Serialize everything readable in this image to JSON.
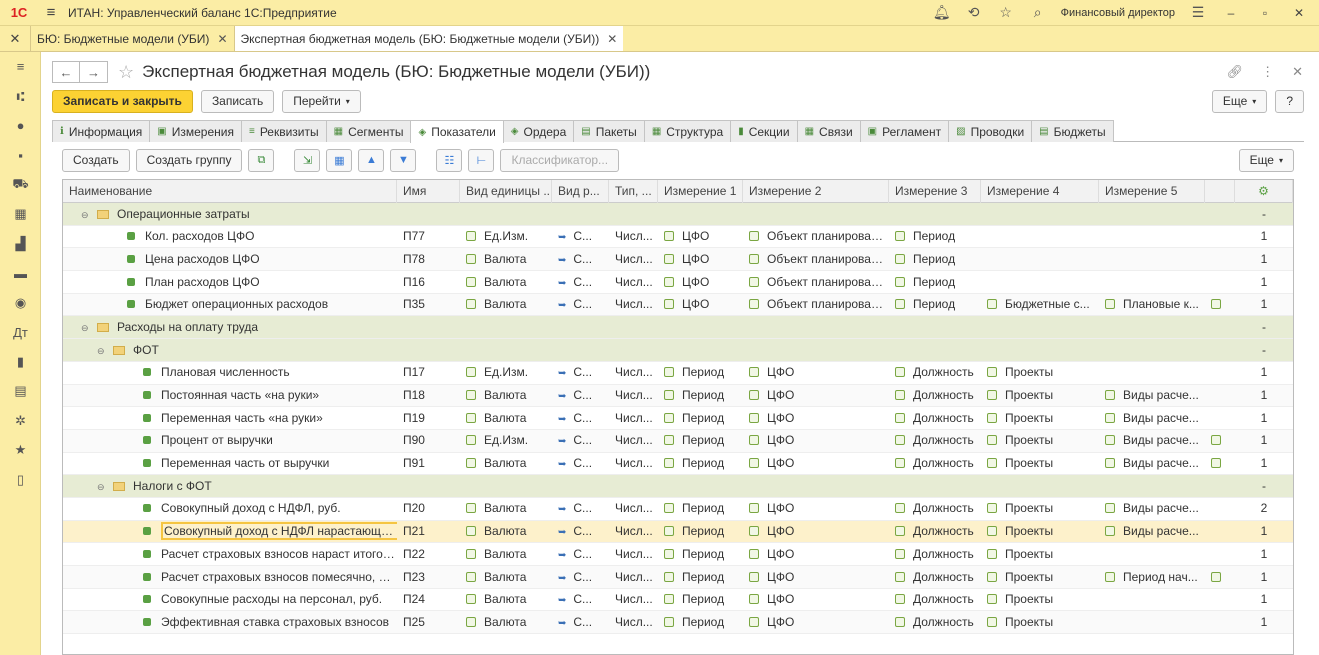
{
  "app": {
    "logo": "1С",
    "title": "ИТАН: Управленческий баланс 1С:Предприятие",
    "user": "Финансовый директор"
  },
  "open_tabs": [
    {
      "label": "БЮ: Бюджетные модели (УБИ)",
      "active": false
    },
    {
      "label": "Экспертная бюджетная модель (БЮ: Бюджетные модели (УБИ))",
      "active": true
    }
  ],
  "form": {
    "title": "Экспертная бюджетная модель (БЮ: Бюджетные модели (УБИ))"
  },
  "commands": {
    "save_close": "Записать и закрыть",
    "save": "Записать",
    "goto": "Перейти",
    "more": "Еще",
    "help": "?"
  },
  "section_tabs": [
    {
      "label": "Информация",
      "icon": "info-icon"
    },
    {
      "label": "Измерения",
      "icon": "dimensions-icon"
    },
    {
      "label": "Реквизиты",
      "icon": "attributes-icon"
    },
    {
      "label": "Сегменты",
      "icon": "segments-icon"
    },
    {
      "label": "Показатели",
      "icon": "indicators-icon",
      "active": true
    },
    {
      "label": "Ордера",
      "icon": "orders-icon"
    },
    {
      "label": "Пакеты",
      "icon": "packages-icon"
    },
    {
      "label": "Структура",
      "icon": "structure-icon"
    },
    {
      "label": "Секции",
      "icon": "sections-icon"
    },
    {
      "label": "Связи",
      "icon": "links-icon"
    },
    {
      "label": "Регламент",
      "icon": "schedule-icon"
    },
    {
      "label": "Проводки",
      "icon": "postings-icon"
    },
    {
      "label": "Бюджеты",
      "icon": "budgets-icon"
    }
  ],
  "table_toolbar": {
    "create": "Создать",
    "create_group": "Создать группу",
    "classifier": "Классификатор...",
    "more": "Еще"
  },
  "columns": [
    "Наименование",
    "Имя",
    "Вид единицы ...",
    "Вид р...",
    "Тип, ...",
    "Измерение 1",
    "Измерение 2",
    "Измерение 3",
    "Измерение 4",
    "Измерение 5",
    "",
    ""
  ],
  "rows": [
    {
      "type": "group",
      "level": 1,
      "name": "Операционные затраты",
      "code": "",
      "unit": "",
      "vid": "",
      "tip": "",
      "d1": "",
      "d2": "",
      "d3": "",
      "d4": "",
      "d5": "",
      "extra": false,
      "n": "-"
    },
    {
      "type": "item",
      "level": 2,
      "name": "Кол. расходов ЦФО",
      "code": "П77",
      "unit": "Ед.Изм.",
      "vid": "С...",
      "tip": "Числ...",
      "d1": "ЦФО",
      "d2": "Объект планирования",
      "d3": "Период",
      "d4": "",
      "d5": "",
      "extra": false,
      "n": "1"
    },
    {
      "type": "item",
      "level": 2,
      "name": "Цена расходов ЦФО",
      "code": "П78",
      "unit": "Валюта",
      "vid": "С...",
      "tip": "Числ...",
      "d1": "ЦФО",
      "d2": "Объект планирования",
      "d3": "Период",
      "d4": "",
      "d5": "",
      "extra": false,
      "n": "1"
    },
    {
      "type": "item",
      "level": 2,
      "name": "План расходов ЦФО",
      "code": "П16",
      "unit": "Валюта",
      "vid": "С...",
      "tip": "Числ...",
      "d1": "ЦФО",
      "d2": "Объект планирования",
      "d3": "Период",
      "d4": "",
      "d5": "",
      "extra": false,
      "n": "1"
    },
    {
      "type": "item",
      "level": 2,
      "name": "Бюджет операционных расходов",
      "code": "П35",
      "unit": "Валюта",
      "vid": "С...",
      "tip": "Числ...",
      "d1": "ЦФО",
      "d2": "Объект планирования",
      "d3": "Период",
      "d4": "Бюджетные с...",
      "d5": "Плановые к...",
      "extra": true,
      "n": "1"
    },
    {
      "type": "group",
      "level": 1,
      "name": "Расходы на оплату труда",
      "code": "",
      "unit": "",
      "vid": "",
      "tip": "",
      "d1": "",
      "d2": "",
      "d3": "",
      "d4": "",
      "d5": "",
      "extra": false,
      "n": "-"
    },
    {
      "type": "group",
      "level": 2,
      "name": "ФОТ",
      "code": "",
      "unit": "",
      "vid": "",
      "tip": "",
      "d1": "",
      "d2": "",
      "d3": "",
      "d4": "",
      "d5": "",
      "extra": false,
      "n": "-"
    },
    {
      "type": "item",
      "level": 3,
      "name": "Плановая численность",
      "code": "П17",
      "unit": "Ед.Изм.",
      "vid": "С...",
      "tip": "Числ...",
      "d1": "Период",
      "d2": "ЦФО",
      "d3": "Должность",
      "d4": "Проекты",
      "d5": "",
      "extra": false,
      "n": "1"
    },
    {
      "type": "item",
      "level": 3,
      "name": "Постоянная часть «на руки»",
      "code": "П18",
      "unit": "Валюта",
      "vid": "С...",
      "tip": "Числ...",
      "d1": "Период",
      "d2": "ЦФО",
      "d3": "Должность",
      "d4": "Проекты",
      "d5": "Виды расче...",
      "extra": false,
      "n": "1"
    },
    {
      "type": "item",
      "level": 3,
      "name": "Переменная часть «на руки»",
      "code": "П19",
      "unit": "Валюта",
      "vid": "С...",
      "tip": "Числ...",
      "d1": "Период",
      "d2": "ЦФО",
      "d3": "Должность",
      "d4": "Проекты",
      "d5": "Виды расче...",
      "extra": false,
      "n": "1"
    },
    {
      "type": "item",
      "level": 3,
      "name": "Процент от выручки",
      "code": "П90",
      "unit": "Ед.Изм.",
      "vid": "С...",
      "tip": "Числ...",
      "d1": "Период",
      "d2": "ЦФО",
      "d3": "Должность",
      "d4": "Проекты",
      "d5": "Виды расче...",
      "extra": true,
      "n": "1"
    },
    {
      "type": "item",
      "level": 3,
      "name": "Переменная часть от выручки",
      "code": "П91",
      "unit": "Валюта",
      "vid": "С...",
      "tip": "Числ...",
      "d1": "Период",
      "d2": "ЦФО",
      "d3": "Должность",
      "d4": "Проекты",
      "d5": "Виды расче...",
      "extra": true,
      "n": "1"
    },
    {
      "type": "group",
      "level": 2,
      "name": "Налоги с ФОТ",
      "code": "",
      "unit": "",
      "vid": "",
      "tip": "",
      "d1": "",
      "d2": "",
      "d3": "",
      "d4": "",
      "d5": "",
      "extra": false,
      "n": "-"
    },
    {
      "type": "item",
      "level": 3,
      "name": "Совокупный доход с НДФЛ, руб.",
      "code": "П20",
      "unit": "Валюта",
      "vid": "С...",
      "tip": "Числ...",
      "d1": "Период",
      "d2": "ЦФО",
      "d3": "Должность",
      "d4": "Проекты",
      "d5": "Виды расче...",
      "extra": false,
      "n": "2"
    },
    {
      "type": "item",
      "level": 3,
      "name": "Совокупный доход с НДФЛ нарастающим ит...",
      "code": "П21",
      "unit": "Валюта",
      "vid": "С...",
      "tip": "Числ...",
      "d1": "Период",
      "d2": "ЦФО",
      "d3": "Должность",
      "d4": "Проекты",
      "d5": "Виды расче...",
      "extra": false,
      "n": "1",
      "selected": true
    },
    {
      "type": "item",
      "level": 3,
      "name": "Расчет страховых взносов нараст итогом, руб",
      "code": "П22",
      "unit": "Валюта",
      "vid": "С...",
      "tip": "Числ...",
      "d1": "Период",
      "d2": "ЦФО",
      "d3": "Должность",
      "d4": "Проекты",
      "d5": "",
      "extra": false,
      "n": "1"
    },
    {
      "type": "item",
      "level": 3,
      "name": "Расчет страховых взносов помесячно, руб.",
      "code": "П23",
      "unit": "Валюта",
      "vid": "С...",
      "tip": "Числ...",
      "d1": "Период",
      "d2": "ЦФО",
      "d3": "Должность",
      "d4": "Проекты",
      "d5": "Период нач...",
      "extra": true,
      "n": "1"
    },
    {
      "type": "item",
      "level": 3,
      "name": "Совокупные расходы на персонал, руб.",
      "code": "П24",
      "unit": "Валюта",
      "vid": "С...",
      "tip": "Числ...",
      "d1": "Период",
      "d2": "ЦФО",
      "d3": "Должность",
      "d4": "Проекты",
      "d5": "",
      "extra": false,
      "n": "1"
    },
    {
      "type": "item",
      "level": 3,
      "name": "Эффективная ставка страховых взносов",
      "code": "П25",
      "unit": "Валюта",
      "vid": "С...",
      "tip": "Числ...",
      "d1": "Период",
      "d2": "ЦФО",
      "d3": "Должность",
      "d4": "Проекты",
      "d5": "",
      "extra": false,
      "n": "1"
    }
  ]
}
